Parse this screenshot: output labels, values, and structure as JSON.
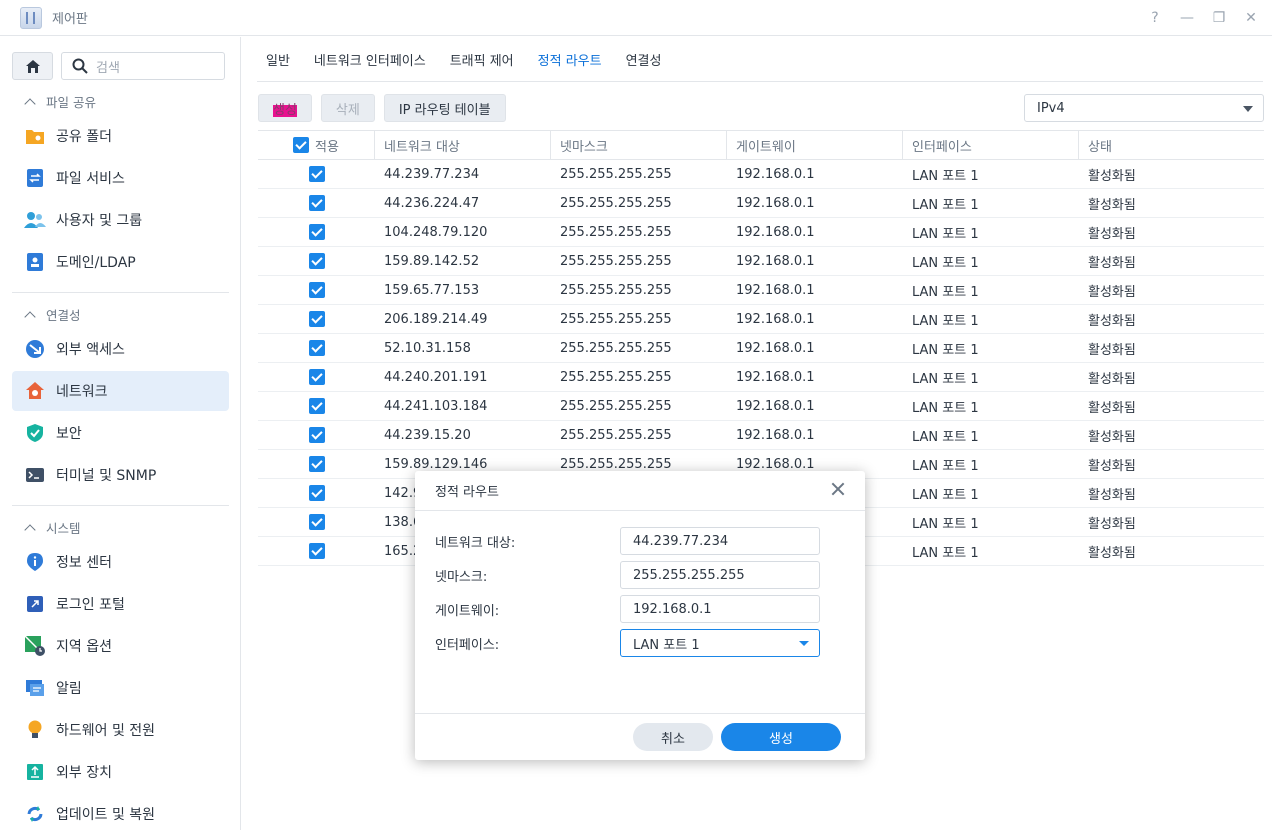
{
  "window": {
    "title": "제어판",
    "controls": [
      "?",
      "—",
      "❐",
      "✕"
    ]
  },
  "sidebar": {
    "search_placeholder": "검색",
    "sections": [
      {
        "label": "파일 공유",
        "items": [
          {
            "label": "공유 폴더",
            "icon": "shared-folder-icon",
            "color": "#f5a623"
          },
          {
            "label": "파일 서비스",
            "icon": "file-services-icon",
            "color": "#2f7bd8"
          },
          {
            "label": "사용자 및 그룹",
            "icon": "user-group-icon",
            "color": "#2f9fd8"
          },
          {
            "label": "도메인/LDAP",
            "icon": "domain-ldap-icon",
            "color": "#2f7bd8"
          }
        ]
      },
      {
        "label": "연결성",
        "items": [
          {
            "label": "외부 액세스",
            "icon": "external-access-icon",
            "color": "#2f7bd8"
          },
          {
            "label": "네트워크",
            "icon": "network-icon",
            "color": "#e8633a",
            "active": true
          },
          {
            "label": "보안",
            "icon": "security-icon",
            "color": "#16b3a0"
          },
          {
            "label": "터미널 및 SNMP",
            "icon": "terminal-icon",
            "color": "#3f5066"
          }
        ]
      },
      {
        "label": "시스템",
        "items": [
          {
            "label": "정보 센터",
            "icon": "info-center-icon",
            "color": "#2f7bd8"
          },
          {
            "label": "로그인 포털",
            "icon": "login-portal-icon",
            "color": "#2f5fb8"
          },
          {
            "label": "지역 옵션",
            "icon": "regional-options-icon",
            "color": "#2aa15c"
          },
          {
            "label": "알림",
            "icon": "notification-icon",
            "color": "#2f7bd8"
          },
          {
            "label": "하드웨어 및 전원",
            "icon": "hardware-power-icon",
            "color": "#f5a623"
          },
          {
            "label": "외부 장치",
            "icon": "external-devices-icon",
            "color": "#16b3a0"
          },
          {
            "label": "업데이트 및 복원",
            "icon": "update-restore-icon",
            "color": "#2f7bd8"
          }
        ]
      }
    ]
  },
  "tabs": [
    {
      "label": "일반"
    },
    {
      "label": "네트워크 인터페이스"
    },
    {
      "label": "트래픽 제어"
    },
    {
      "label": "정적 라우트",
      "active": true
    },
    {
      "label": "연결성"
    }
  ],
  "toolbar": {
    "create": "생성",
    "delete": "삭제",
    "ip_routing_table": "IP 라우팅 테이블",
    "ip_version": "IPv4"
  },
  "table": {
    "headers": [
      "적용",
      "네트워크 대상",
      "넷마스크",
      "게이트웨이",
      "인터페이스",
      "상태"
    ],
    "rows": [
      [
        "44.239.77.234",
        "255.255.255.255",
        "192.168.0.1",
        "LAN 포트 1",
        "활성화됨"
      ],
      [
        "44.236.224.47",
        "255.255.255.255",
        "192.168.0.1",
        "LAN 포트 1",
        "활성화됨"
      ],
      [
        "104.248.79.120",
        "255.255.255.255",
        "192.168.0.1",
        "LAN 포트 1",
        "활성화됨"
      ],
      [
        "159.89.142.52",
        "255.255.255.255",
        "192.168.0.1",
        "LAN 포트 1",
        "활성화됨"
      ],
      [
        "159.65.77.153",
        "255.255.255.255",
        "192.168.0.1",
        "LAN 포트 1",
        "활성화됨"
      ],
      [
        "206.189.214.49",
        "255.255.255.255",
        "192.168.0.1",
        "LAN 포트 1",
        "활성화됨"
      ],
      [
        "52.10.31.158",
        "255.255.255.255",
        "192.168.0.1",
        "LAN 포트 1",
        "활성화됨"
      ],
      [
        "44.240.201.191",
        "255.255.255.255",
        "192.168.0.1",
        "LAN 포트 1",
        "활성화됨"
      ],
      [
        "44.241.103.184",
        "255.255.255.255",
        "192.168.0.1",
        "LAN 포트 1",
        "활성화됨"
      ],
      [
        "44.239.15.20",
        "255.255.255.255",
        "192.168.0.1",
        "LAN 포트 1",
        "활성화됨"
      ],
      [
        "159.89.129.146",
        "255.255.255.255",
        "192.168.0.1",
        "LAN 포트 1",
        "활성화됨"
      ],
      [
        "142.9",
        "",
        "",
        "LAN 포트 1",
        "활성화됨"
      ],
      [
        "138.6",
        "",
        "",
        "LAN 포트 1",
        "활성화됨"
      ],
      [
        "165.2",
        "",
        "",
        "LAN 포트 1",
        "활성화됨"
      ]
    ]
  },
  "modal": {
    "title": "정적 라우트",
    "fields": [
      {
        "label": "네트워크 대상:",
        "value": "44.239.77.234"
      },
      {
        "label": "넷마스크:",
        "value": "255.255.255.255"
      },
      {
        "label": "게이트웨이:",
        "value": "192.168.0.1"
      },
      {
        "label": "인터페이스:",
        "value": "LAN 포트 1"
      }
    ],
    "cancel": "취소",
    "create": "생성"
  },
  "colors": {
    "accent": "#1a86e8",
    "active_bg": "#e4eefa",
    "highlight": "#e8118f"
  }
}
